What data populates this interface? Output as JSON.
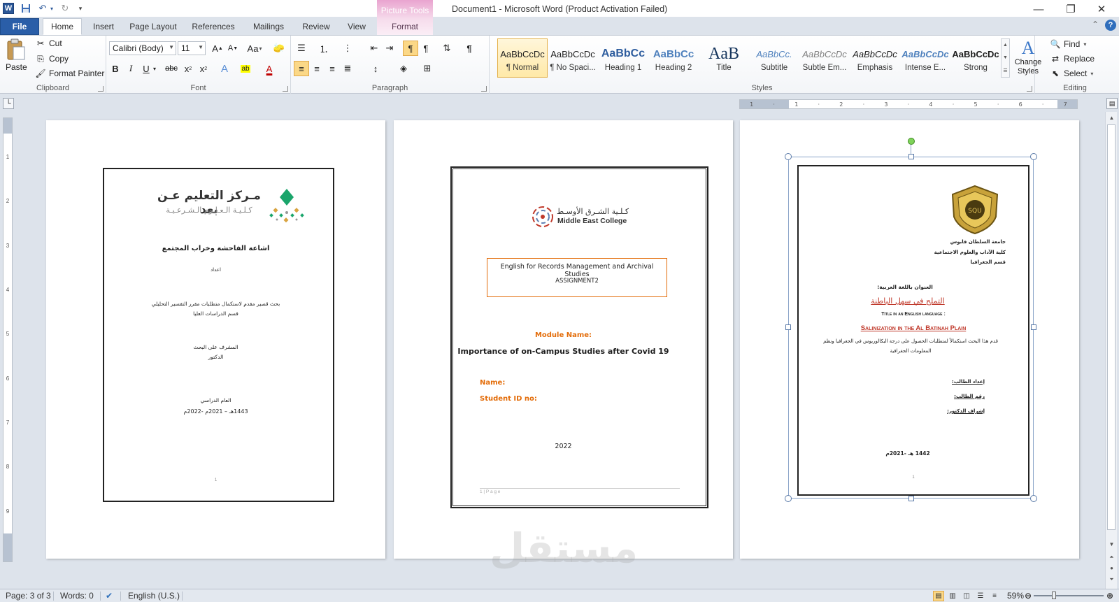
{
  "window": {
    "title": "Document1  -  Microsoft Word (Product Activation Failed)",
    "contextual_group": "Picture Tools"
  },
  "quick_access": {
    "icons": [
      "word-icon",
      "save-icon",
      "undo-icon",
      "redo-icon",
      "customize-icon"
    ]
  },
  "tabs": [
    {
      "label": "File"
    },
    {
      "label": "Home"
    },
    {
      "label": "Insert"
    },
    {
      "label": "Page Layout"
    },
    {
      "label": "References"
    },
    {
      "label": "Mailings"
    },
    {
      "label": "Review"
    },
    {
      "label": "View"
    },
    {
      "label": "Format"
    }
  ],
  "ribbon": {
    "clipboard": {
      "label": "Clipboard",
      "paste": "Paste",
      "cut": "Cut",
      "copy": "Copy",
      "format_painter": "Format Painter"
    },
    "font": {
      "label": "Font",
      "font_name": "Calibri (Body)",
      "font_size": "11",
      "bold": "B",
      "italic": "I",
      "underline": "U",
      "strike": "abc",
      "change_case": "Aa"
    },
    "paragraph": {
      "label": "Paragraph"
    },
    "styles": {
      "label": "Styles",
      "items": [
        {
          "preview": "AaBbCcDc",
          "name": "¶ Normal"
        },
        {
          "preview": "AaBbCcDc",
          "name": "¶ No Spaci..."
        },
        {
          "preview": "AaBbCc",
          "name": "Heading 1"
        },
        {
          "preview": "AaBbCc",
          "name": "Heading 2"
        },
        {
          "preview": "AaB",
          "name": "Title"
        },
        {
          "preview": "AaBbCc.",
          "name": "Subtitle"
        },
        {
          "preview": "AaBbCcDc",
          "name": "Subtle Em..."
        },
        {
          "preview": "AaBbCcDc",
          "name": "Emphasis"
        },
        {
          "preview": "AaBbCcDc",
          "name": "Intense E..."
        },
        {
          "preview": "AaBbCcDc",
          "name": "Strong"
        }
      ],
      "change_styles": "Change Styles"
    },
    "editing": {
      "label": "Editing",
      "find": "Find",
      "replace": "Replace",
      "select": "Select"
    }
  },
  "page1": {
    "logo_line1": "مـركز التعليم عـن بعد",
    "logo_line2": "كـلـيـة الـعـلـوم الـشـرعـيـة",
    "title": "اشاعة الفاحشة وخراب المجتمع",
    "prepared_by": "اعداد",
    "desc1": "بحث قصير مقدم لاستكمال متطلبات مقرر التفسير التحليلي",
    "desc2": "قسم الدراسات العليا",
    "supervisor": "المشرف على البحث",
    "doctor": "الدكتور",
    "year_label": "العام الدراسي",
    "year": "1443هـ  –  2021م  -2022م",
    "page_num": "1"
  },
  "page2": {
    "logo_ar": "كـلـية الشـرق الأوسـط",
    "logo_en": "Middle East College",
    "box_line1": "English for Records Management and Archival Studies",
    "box_line2": "ASSIGNMENT2",
    "module_label": "Module Name:",
    "topic": "Importance of on-Campus Studies after Covid 19",
    "name_label": "Name:",
    "id_label": "Student ID no:",
    "year": "2022",
    "footer": "1 | P a g e"
  },
  "page3": {
    "seal_label": "SQU",
    "uni1": "جامعة السلطان قابوس",
    "uni2": "كلية الآداب والعلوم الاجتماعية",
    "uni3": "قسم الجغرافيا",
    "ar_title_label": "العنوان باللغة العربية:",
    "ar_title": "التملح في سهل الباطنة",
    "en_title_label": "Title in an English language :",
    "en_title": "Salinization in the Al Batinah Plain",
    "desc1": "قدم هذا البحث استكمالاً لمتطلبات الحصول على درجة البكالوريوس في الجغرافيا ونظم",
    "desc2": "المعلومات الجغرافية",
    "prep": "إعداد الطالب:",
    "student_no": "رقم الطالب:",
    "supervision": "إشراف الدكتور:",
    "year": "1442 هـ  -2021م",
    "page_num": "1"
  },
  "statusbar": {
    "page": "Page: 3 of 3",
    "words": "Words: 0",
    "language": "English (U.S.)",
    "zoom": "59%"
  },
  "watermark": "مستقل",
  "colors": {
    "file_tab": "#2a5ea8",
    "orange_accent": "#e36c09",
    "red_title": "#c0392b"
  }
}
